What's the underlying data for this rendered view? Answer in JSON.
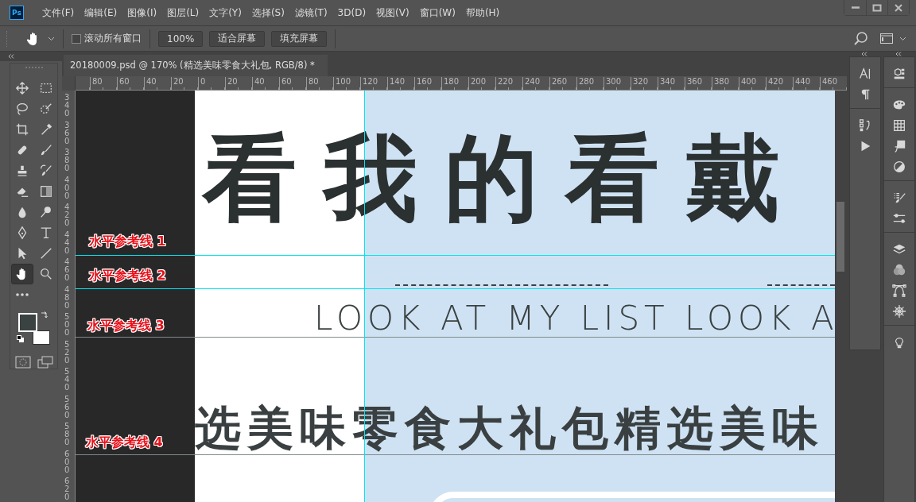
{
  "menu_bar": {
    "logo": "Ps",
    "menus": [
      "文件(F)",
      "编辑(E)",
      "图像(I)",
      "图层(L)",
      "文字(Y)",
      "选择(S)",
      "滤镜(T)",
      "3D(D)",
      "视图(V)",
      "窗口(W)",
      "帮助(H)"
    ]
  },
  "options_bar": {
    "scroll_all_windows": {
      "label": "滚动所有窗口",
      "checked": false
    },
    "buttons": [
      "100%",
      "适合屏幕",
      "填充屏幕"
    ]
  },
  "tools": [
    {
      "kind": "move",
      "selected": false
    },
    {
      "kind": "marquee",
      "selected": false
    },
    {
      "kind": "lasso",
      "selected": false
    },
    {
      "kind": "quick-select",
      "selected": false
    },
    {
      "kind": "crop",
      "selected": false
    },
    {
      "kind": "eyedropper",
      "selected": false
    },
    {
      "kind": "healing",
      "selected": false
    },
    {
      "kind": "brush",
      "selected": false
    },
    {
      "kind": "stamp",
      "selected": false
    },
    {
      "kind": "history-brush",
      "selected": false
    },
    {
      "kind": "eraser",
      "selected": false
    },
    {
      "kind": "gradient",
      "selected": false
    },
    {
      "kind": "blur",
      "selected": false
    },
    {
      "kind": "dodge",
      "selected": false
    },
    {
      "kind": "pen",
      "selected": false
    },
    {
      "kind": "type",
      "selected": false
    },
    {
      "kind": "path-select",
      "selected": false
    },
    {
      "kind": "line",
      "selected": false
    },
    {
      "kind": "hand",
      "selected": true
    },
    {
      "kind": "zoom",
      "selected": false
    },
    {
      "kind": "more",
      "selected": false
    }
  ],
  "document_tab": {
    "title": "20180009.psd @ 170% (精选美味零食大礼包, RGB/8) *"
  },
  "horizontal_ruler": [
    "80",
    "60",
    "40",
    "20",
    "0",
    "20",
    "40",
    "60",
    "80",
    "100",
    "120",
    "140",
    "160",
    "180",
    "200",
    "220",
    "240",
    "260",
    "280",
    "300",
    "320",
    "340",
    "360",
    "380",
    "400",
    "420",
    "440",
    "460"
  ],
  "vertical_ruler": [
    "340",
    "360",
    "380",
    "400",
    "420",
    "440",
    "460",
    "480",
    "500",
    "520",
    "540",
    "560",
    "580",
    "600",
    "620"
  ],
  "canvas": {
    "title_art": "看我的看戴",
    "subtitle": "LOOK AT MY LIST LOOK A",
    "banner_text": "选美味零食大礼包精选美味",
    "guide_labels": [
      "水平参考线 1",
      "水平参考线 2",
      "水平参考线 3",
      "水平参考线 4"
    ]
  }
}
